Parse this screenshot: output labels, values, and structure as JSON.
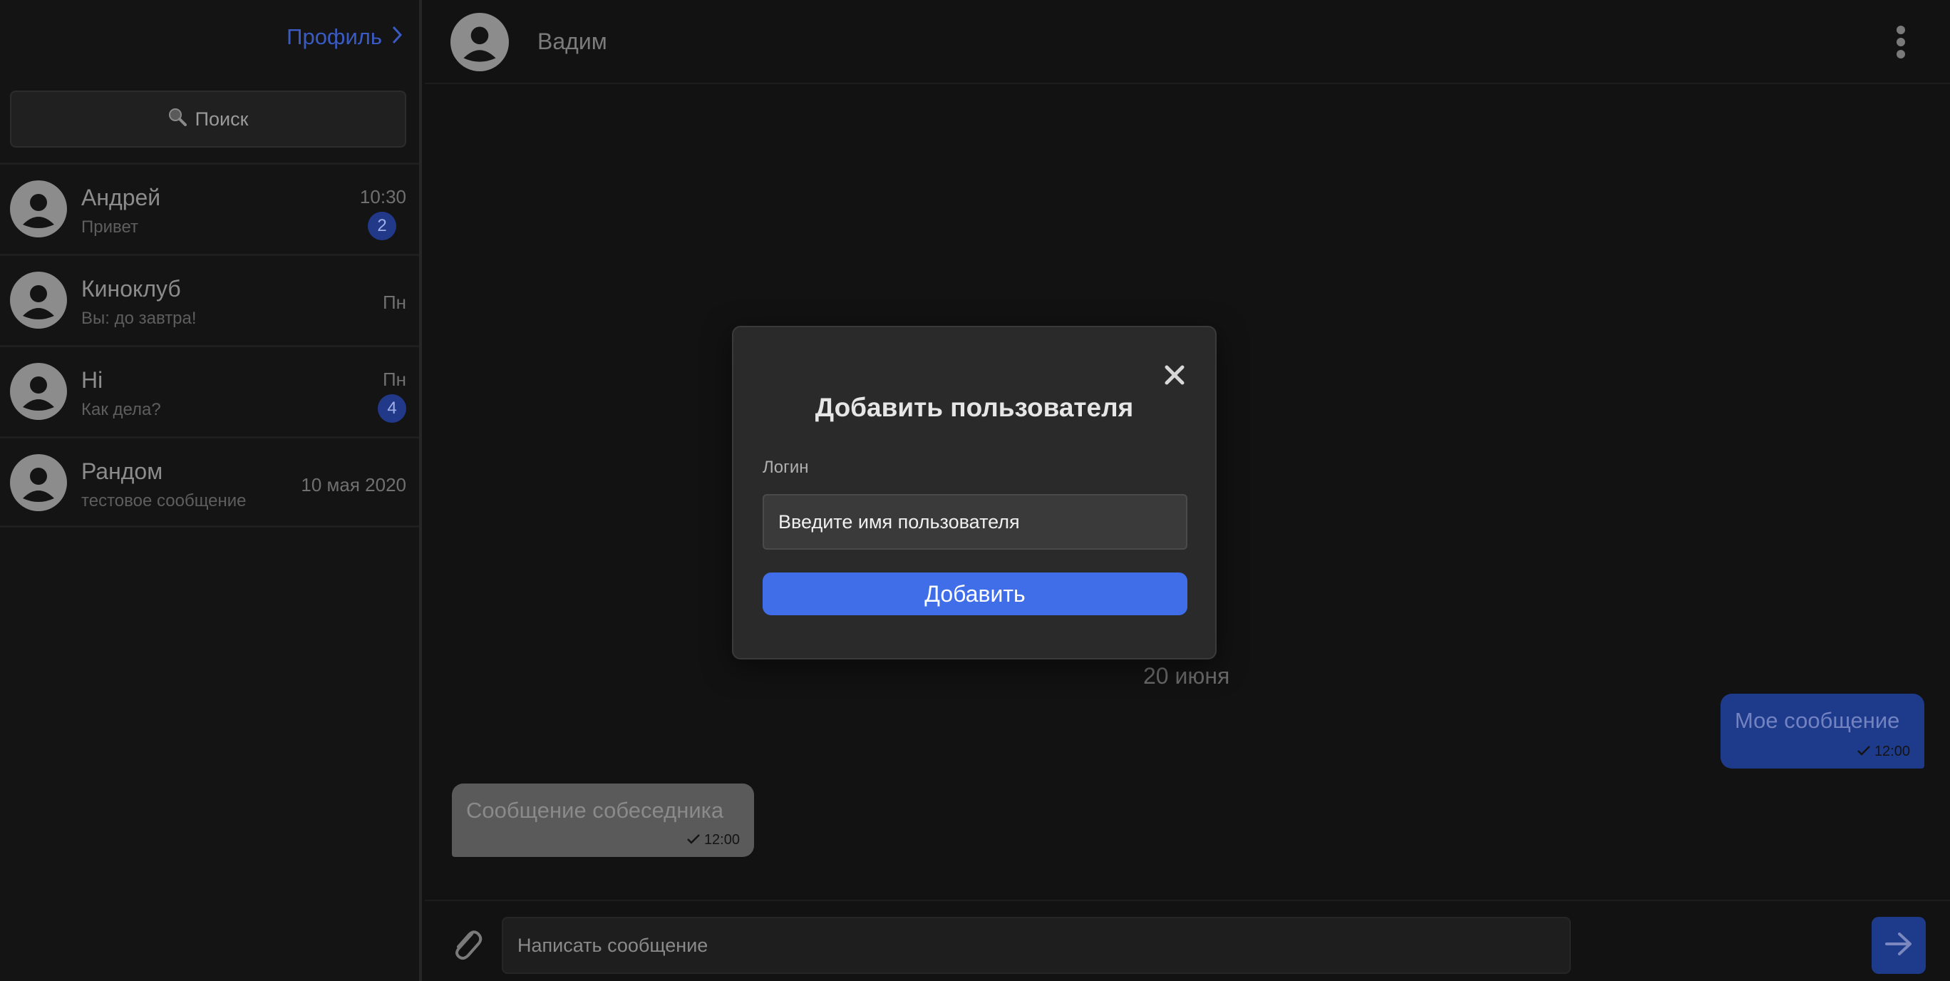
{
  "sidebar": {
    "profile_link": "Профиль",
    "search_label": "Поиск",
    "chats": [
      {
        "name": "Андрей",
        "preview": "Привет",
        "time": "10:30",
        "unread": "2"
      },
      {
        "name": "Киноклуб",
        "preview": "Вы: до завтра!",
        "time": "Пн",
        "unread": ""
      },
      {
        "name": "Hi",
        "preview": "Как дела?",
        "time": "Пн",
        "unread": "4"
      },
      {
        "name": "Рандом",
        "preview": "тестовое сообщение",
        "time": "10 мая 2020",
        "unread": ""
      }
    ]
  },
  "chat": {
    "contact_name": "Вадим",
    "date_separator": "20 июня",
    "messages": [
      {
        "direction": "outgoing",
        "text": "Мое сообщение",
        "time": "12:00"
      },
      {
        "direction": "incoming",
        "text": "Сообщение собеседника",
        "time": "12:00"
      }
    ],
    "composer_placeholder": "Написать сообщение"
  },
  "modal": {
    "title": "Добавить пользователя",
    "login_label": "Логин",
    "login_placeholder": "Введите имя пользователя",
    "submit_label": "Добавить"
  },
  "colors": {
    "background": "#121212",
    "accent": "#3f6ee8",
    "accent_dim": "#1e3a8a",
    "link": "#3b5bc4",
    "modal_bg": "#2a2a2a"
  },
  "icons": {
    "profile_chevron": "chevron-right-icon",
    "search": "magnifier-icon",
    "avatar": "user-avatar-icon",
    "menu": "kebab-menu-icon",
    "attach": "paperclip-icon",
    "send": "arrow-right-icon",
    "close": "close-icon",
    "read": "checkmark-icon"
  }
}
